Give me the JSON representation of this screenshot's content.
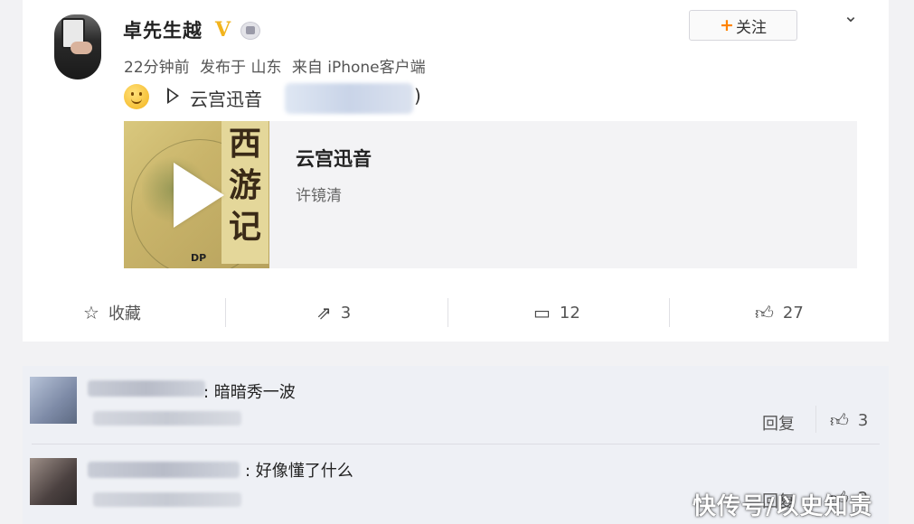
{
  "post": {
    "user_name": "卓先生越",
    "vip_badge": "V",
    "meta": {
      "time": "22分钟前",
      "posted_at": "发布于 山东",
      "source": "来自 iPhone客户端"
    },
    "follow_label": "关注",
    "follow_plus": "+",
    "music_link_label": "云宫迅音",
    "close_paren": ")",
    "media": {
      "cover_title": "西游记",
      "cover_publisher": "DP",
      "song_title": "云宫迅音",
      "artist": "许镜清"
    },
    "actions": {
      "favorite_label": "收藏",
      "repost_count": "3",
      "comment_count": "12",
      "like_count": "27"
    }
  },
  "comments": [
    {
      "text": ": 暗暗秀一波",
      "reply_label": "回复",
      "like_count": "3"
    },
    {
      "text": ": 好像懂了什么",
      "reply_label": "回复",
      "like_count": "2"
    }
  ],
  "watermark": "快传号/以史知责",
  "colors": {
    "accent": "#ff8200",
    "vip": "#f2b41e",
    "background": "#f2f2f4",
    "comment_bg": "#eef0f5"
  }
}
